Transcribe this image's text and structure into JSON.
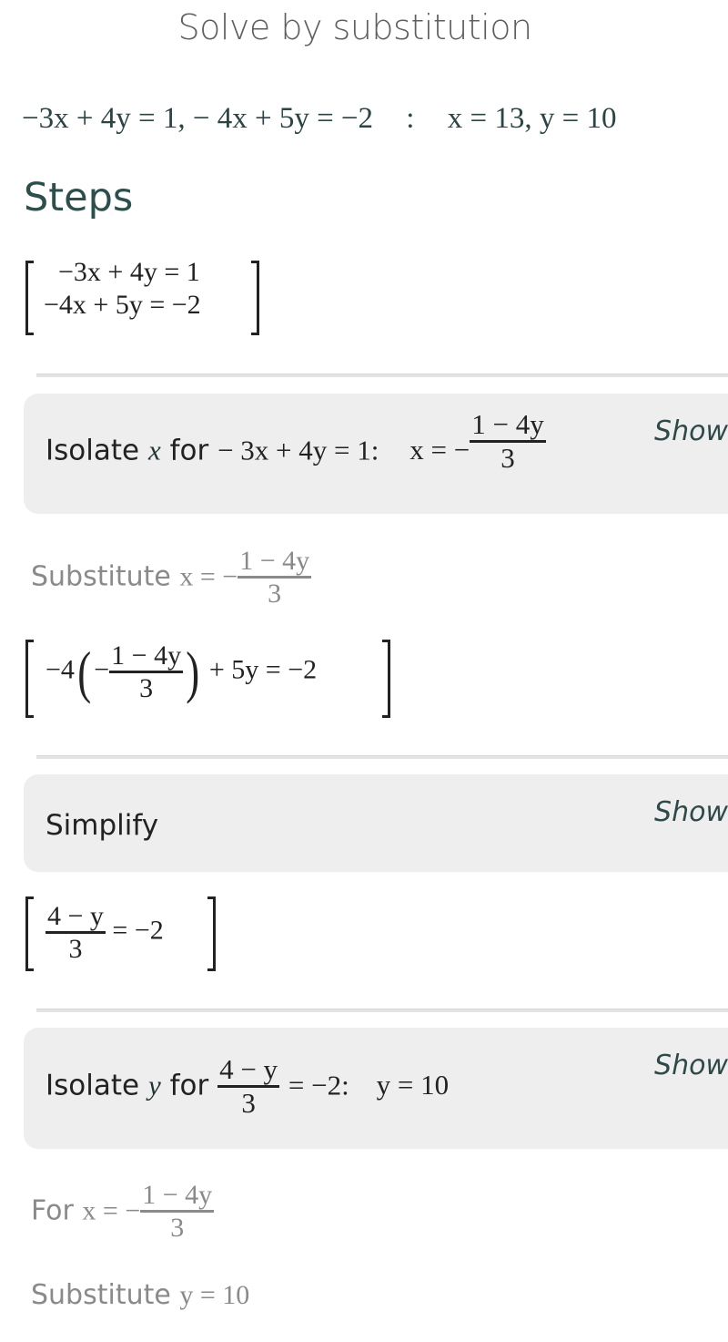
{
  "header": {
    "title": "Solve by substitution"
  },
  "summary": {
    "equation_1": "−3x + 4y = 1,",
    "equation_2": "− 4x + 5y = −2",
    "separator": ":",
    "solution": "x = 13, y = 10",
    "solution_x": "x",
    "solution_x_val": "= 13,",
    "solution_y": "y",
    "solution_y_val": "= 10"
  },
  "steps_heading": "Steps",
  "system": {
    "row_1": "−3x + 4y = 1",
    "row_2": "−4x + 5y = −2"
  },
  "steps": [
    {
      "label_prefix": "Isolate",
      "variable": "x",
      "label_mid": "for",
      "equation": "− 3x + 4y = 1:",
      "result_lhs": "x = −",
      "result_num": "1 − 4y",
      "result_den": "3",
      "show_label": "Show"
    },
    {
      "label": "Simplify",
      "show_label": "Show"
    },
    {
      "label_prefix": "Isolate",
      "variable": "y",
      "label_mid": "for",
      "frac_num": "4 − y",
      "frac_den": "3",
      "equation_rest": "= −2:",
      "result": "y = 10",
      "show_label": "Show"
    }
  ],
  "substitute_x": {
    "label": "Substitute",
    "lhs": "x = −",
    "num": "1 − 4y",
    "den": "3"
  },
  "substituted_equation": {
    "prefix": "−4",
    "inner_sign": "−",
    "num": "1 − 4y",
    "den": "3",
    "suffix": "+ 5y = −2"
  },
  "simplified_equation": {
    "num": "4 − y",
    "den": "3",
    "suffix": "= −2"
  },
  "for_x": {
    "label": "For",
    "lhs": "x = −",
    "num": "1 − 4y",
    "den": "3"
  },
  "substitute_y": {
    "label": "Substitute",
    "expr": "y = 10"
  },
  "colors": {
    "heading": "#2c4e4c",
    "box_background": "#eeeeee",
    "muted_text": "#8a8a8a",
    "link": "#2e4a48"
  }
}
